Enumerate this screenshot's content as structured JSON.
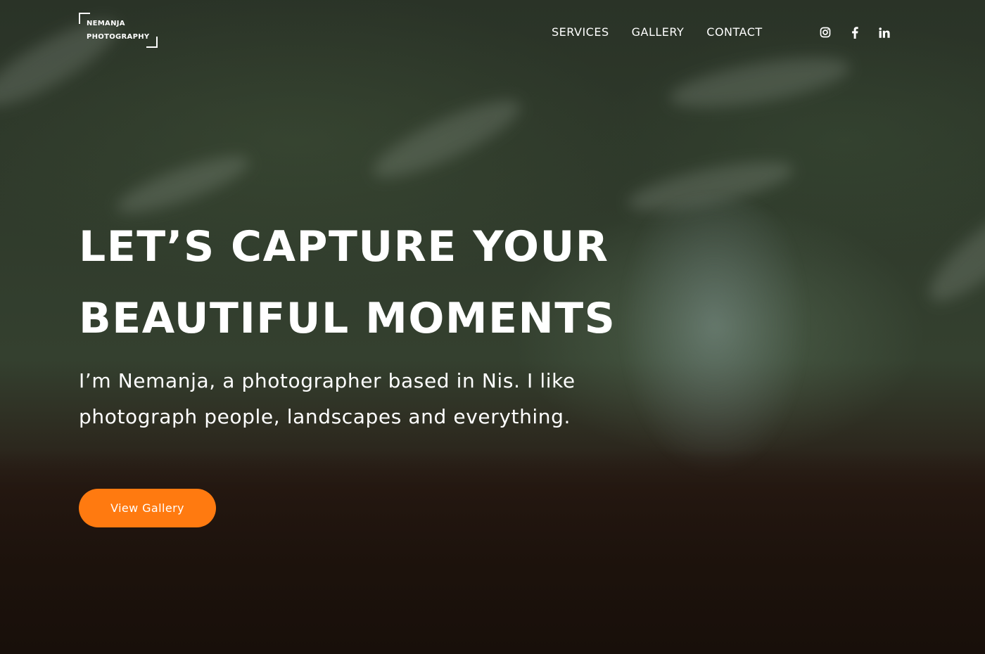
{
  "brand": {
    "line1": "NEMANJA",
    "line2": "PHOTOGRAPHY"
  },
  "nav": {
    "items": [
      "SERVICES",
      "GALLERY",
      "CONTACT"
    ]
  },
  "social": {
    "icons": [
      "instagram-icon",
      "facebook-icon",
      "linkedin-icon"
    ]
  },
  "hero": {
    "headline_line1": "LET’S CAPTURE YOUR",
    "headline_line2": "BEAUTIFUL MOMENTS",
    "subtext": "I’m Nemanja, a photographer based in Nis. I like photograph people, landscapes and everything.",
    "cta_label": "View Gallery"
  },
  "colors": {
    "accent": "#ff7a10",
    "text": "#ffffff"
  }
}
